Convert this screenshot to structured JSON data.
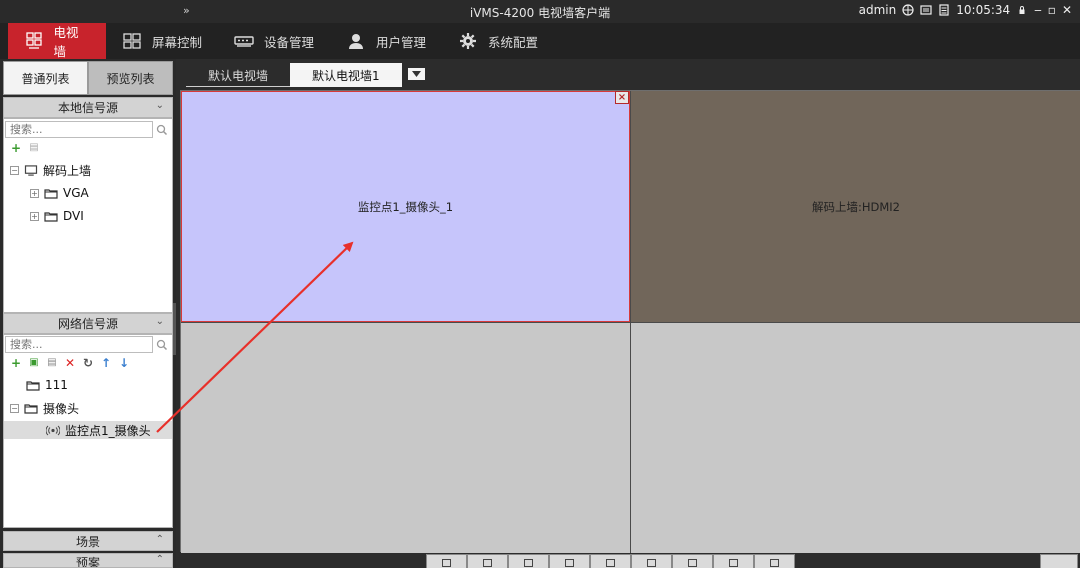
{
  "titlebar": {
    "chevron": "»",
    "title": "iVMS-4200 电视墙客户端",
    "user": "admin",
    "time": "10:05:34",
    "min": "‒",
    "max": "▫",
    "close": "✕"
  },
  "nav": {
    "items": [
      {
        "label": "电视墙",
        "icon": "video-wall-icon"
      },
      {
        "label": "屏幕控制",
        "icon": "screen-grid-icon"
      },
      {
        "label": "设备管理",
        "icon": "device-icon"
      },
      {
        "label": "用户管理",
        "icon": "user-icon"
      },
      {
        "label": "系统配置",
        "icon": "gear-icon"
      }
    ]
  },
  "left": {
    "tabs": [
      "普通列表",
      "预览列表"
    ],
    "local_section": "本地信号源",
    "local_search_placeholder": "搜索...",
    "local_tree": {
      "root": "解码上墙",
      "children": [
        "VGA",
        "DVI"
      ]
    },
    "network_section": "网络信号源",
    "network_search_placeholder": "搜索...",
    "network_tree": {
      "folder1": "111",
      "folder2": "摄像头",
      "camera": "监控点1_摄像头"
    },
    "scene_section": "场景",
    "plan_section": "预案"
  },
  "main": {
    "tabs": [
      "默认电视墙",
      "默认电视墙1"
    ],
    "cells": [
      "监控点1_摄像头_1",
      "解码上墙:HDMI2",
      "",
      ""
    ],
    "close_label": "×"
  },
  "colors": {
    "accent": "#c8232c",
    "selected_cell": "#c6c5fb",
    "hdmi_cell": "#71665a",
    "arrow": "#e8302a"
  }
}
